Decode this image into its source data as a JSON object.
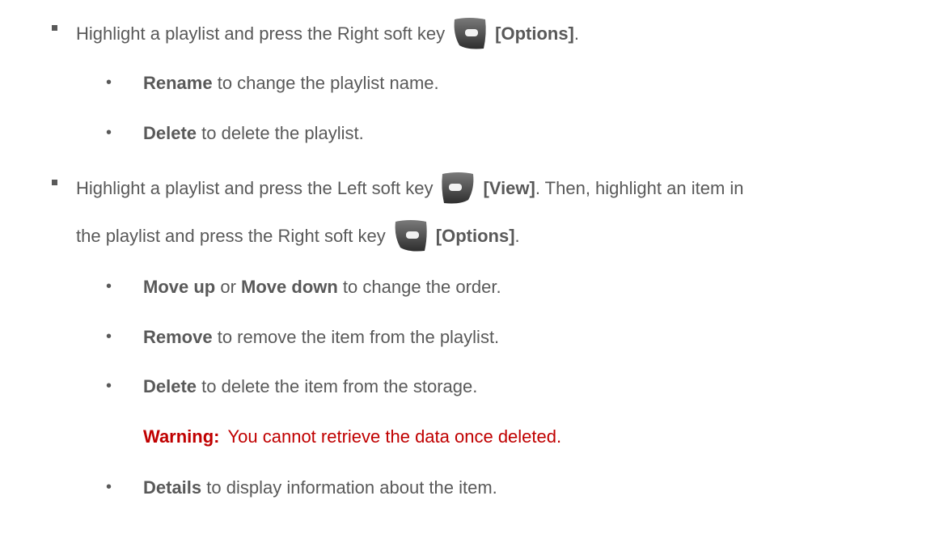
{
  "items": [
    {
      "prefix": "Highlight a playlist and press the Right soft key",
      "key_icon": "right-soft-key-icon",
      "bold": "[Options]",
      "suffix": "."
    },
    {
      "bold": "Rename",
      "text": " to change the playlist name."
    },
    {
      "bold": "Delete",
      "text": " to delete the playlist."
    },
    {
      "prefix": "Highlight a playlist and press the Left soft key",
      "key_icon": "left-soft-key-icon",
      "bold": "[View]",
      "suffix": ". Then, highlight an item in"
    },
    {
      "prefix": "the playlist and press the Right soft key",
      "key_icon": "right-soft-key-icon",
      "bold": "[Options]",
      "suffix": "."
    },
    {
      "bold": "Move up",
      "mid": " or ",
      "bold2": "Move down",
      "text": " to change the order."
    },
    {
      "bold": "Remove",
      "text": " to remove the item from the playlist."
    },
    {
      "bold": "Delete",
      "text": " to delete the item from the storage."
    },
    {
      "warning_label": "Warning:",
      "warning_text": "You cannot retrieve the data once deleted."
    },
    {
      "bold": "Details",
      "text": " to display information about the item."
    }
  ],
  "colors": {
    "text": "#595959",
    "warning": "#c00000"
  }
}
